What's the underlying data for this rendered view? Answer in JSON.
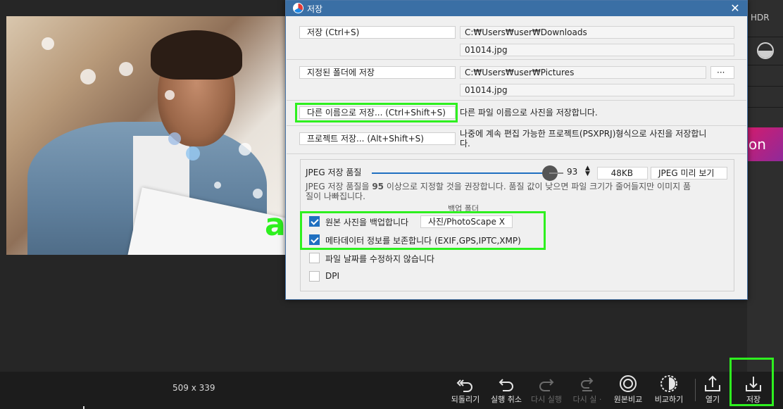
{
  "dialog": {
    "title": "저장",
    "close_label": "✕",
    "save": {
      "button": "저장  (Ctrl+S)",
      "path": "C:₩Users₩user₩Downloads",
      "filename": "01014.jpg"
    },
    "save_to_folder": {
      "button": "지정된 폴더에 저장",
      "path": "C:₩Users₩user₩Pictures",
      "browse": "···",
      "filename": "01014.jpg"
    },
    "save_as": {
      "button": "다른 이름으로 저장...   (Ctrl+Shift+S)",
      "description": "다른 파일 이름으로 사진을 저장합니다."
    },
    "save_project": {
      "button": "프로젝트 저장...   (Alt+Shift+S)",
      "description_line1": "나중에 계속 편집 가능한 프로젝트(PSXPRJ)형식으로 사진을 저장합니",
      "description_line2": "다."
    },
    "jpeg": {
      "quality_label": "JPEG 저장 품질",
      "quality_value": "93",
      "quality_fraction": 0.93,
      "file_size": "48KB",
      "preview_button": "JPEG 미리 보기",
      "hint_line1_a": "JPEG 저장 품질을 ",
      "hint_line1_b": "95",
      "hint_line1_c": " 이상으로 지정할 것을 권장합니다. 품질 값이 낮으면 파일 크기가 줄어들지만 이미지 품",
      "hint_line2": "질이 나빠집니다.",
      "backup_folder_caption": "백업 폴더"
    },
    "options": [
      {
        "label": "원본 사진을 백업합니다",
        "checked": true
      },
      {
        "label": "메타데이터 정보를 보존합니다 (EXIF,GPS,IPTC,XMP)",
        "checked": true
      },
      {
        "label": "파일 날짜를 수정하지 않습니다",
        "checked": false
      },
      {
        "label": "DPI",
        "checked": false
      }
    ],
    "backup_folder": "사진/PhotoScape X"
  },
  "annotation_letter": "a",
  "side_panel": {
    "hdr": "HDR",
    "tile_text": "on"
  },
  "statusbar": {
    "dimensions": "509 x 339"
  },
  "toolbar": [
    {
      "label": "되돌리기",
      "icon": "revert-icon",
      "enabled": true
    },
    {
      "label": "실행 취소",
      "icon": "undo-icon",
      "enabled": true
    },
    {
      "label": "다시 실행",
      "icon": "redo-icon",
      "enabled": false
    },
    {
      "label": "다시 실 ·",
      "icon": "redo-all-icon",
      "enabled": false
    },
    {
      "label": "원본비교",
      "icon": "compare-original-icon",
      "enabled": true
    },
    {
      "label": "비교하기",
      "icon": "compare-icon",
      "enabled": true
    },
    {
      "label": "열기",
      "icon": "open-icon",
      "enabled": true
    },
    {
      "label": "저장",
      "icon": "save-icon",
      "enabled": true
    }
  ],
  "colors": {
    "highlight": "#2ef01f",
    "titlebar": "#3a6fa5",
    "accent": "#1f6fc0"
  }
}
